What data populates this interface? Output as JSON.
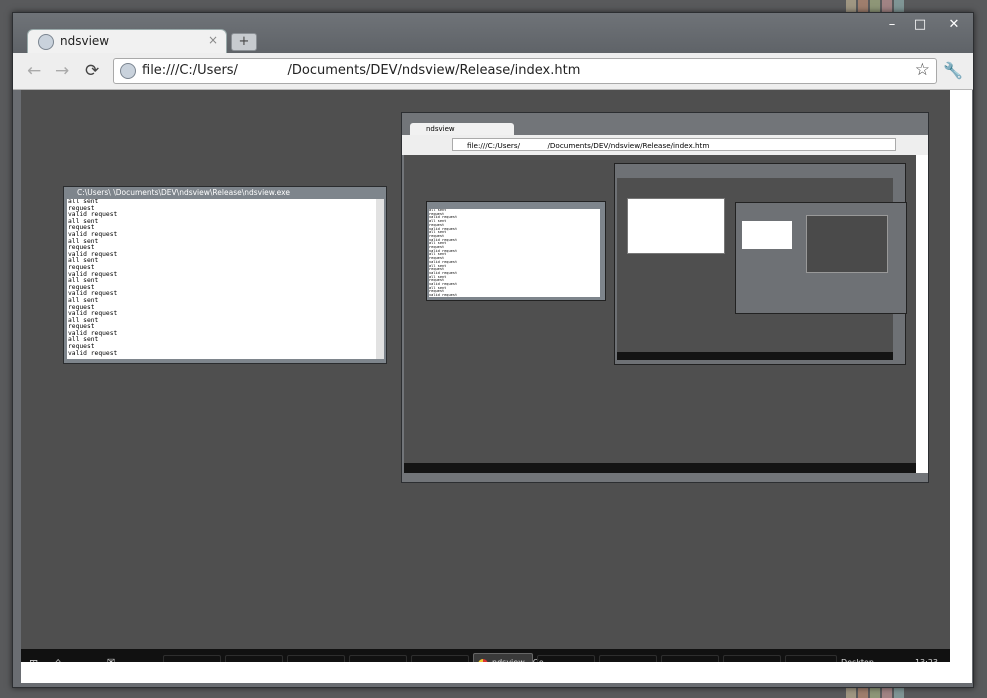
{
  "window": {
    "controls": [
      "–",
      "□",
      "✕"
    ]
  },
  "tab": {
    "title": "ndsview",
    "close": "×",
    "new_tab": "+"
  },
  "omnibox": {
    "url": "file:///C:/Users/            /Documents/DEV/ndsview/Release/index.htm"
  },
  "console": {
    "title": "C:\\Users\\          \\Documents\\DEV\\ndsview\\Release\\ndsview.exe",
    "lines": [
      "all sent",
      "request",
      "valid request",
      "all sent",
      "request",
      "valid request",
      "all sent",
      "request",
      "valid request",
      "all sent",
      "request",
      "valid request",
      "all sent",
      "request",
      "valid request",
      "all sent",
      "request",
      "valid request",
      "all sent",
      "request",
      "valid request",
      "all sent",
      "request",
      "valid request"
    ]
  },
  "nested": {
    "tab_title": "ndsview",
    "url": "file:///C:/Users/            /Documents/DEV/ndsview/Release/index.htm",
    "console_lines": [
      "all sent",
      "request",
      "valid request",
      "all sent",
      "request",
      "valid request",
      "all sent",
      "request",
      "valid request",
      "all sent",
      "request",
      "valid request",
      "all sent",
      "request",
      "valid request",
      "all sent",
      "request",
      "valid request",
      "all sent",
      "request",
      "valid request",
      "all sent",
      "request",
      "valid request"
    ]
  },
  "taskbar": {
    "active_task": "ndsview - Go...",
    "desktop": "Desktop",
    "clock": "13:23"
  },
  "colors": {
    "stripes": [
      "#d8c9a2",
      "#d89c7b",
      "#b9c98e",
      "#dca6a6",
      "#9fc6c4",
      "#c9d6e2"
    ]
  }
}
